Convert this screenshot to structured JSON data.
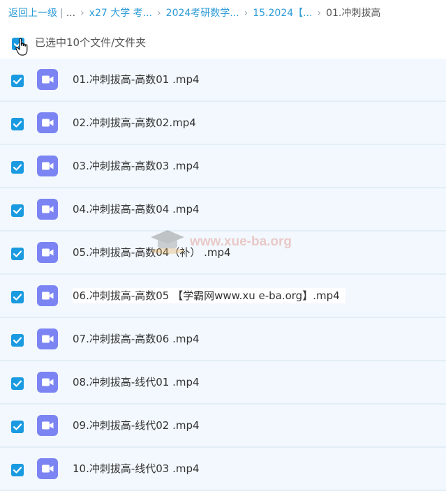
{
  "breadcrumb": {
    "back": "返回上一级",
    "ellipsis": "...",
    "crumb1": "x27 大学 考...",
    "crumb2": "2024考研数学...",
    "crumb3": "15.2024【...",
    "current": "01.冲刺拔高"
  },
  "selection": {
    "text": "已选中10个文件/文件夹",
    "all_checked": true
  },
  "files": [
    {
      "name": "01.冲刺拔高-高数01 .mp4",
      "checked": true
    },
    {
      "name": "02.冲刺拔高-高数02.mp4",
      "checked": true
    },
    {
      "name": "03.冲刺拔高-高数03 .mp4",
      "checked": true
    },
    {
      "name": "04.冲刺拔高-高数04 .mp4",
      "checked": true
    },
    {
      "name": "05.冲刺拔高-高数04（补） .mp4",
      "checked": true
    },
    {
      "name": "06.冲刺拔高-高数05 【学霸网www.xu e-ba.org】.mp4",
      "checked": true
    },
    {
      "name": "07.冲刺拔高-高数06 .mp4",
      "checked": true
    },
    {
      "name": "08.冲刺拔高-线代01 .mp4",
      "checked": true
    },
    {
      "name": "09.冲刺拔高-线代02 .mp4",
      "checked": true
    },
    {
      "name": "10.冲刺拔高-线代03 .mp4",
      "checked": true
    }
  ],
  "watermark": "www.xue-ba.org",
  "colors": {
    "accent": "#2c9bd8",
    "checkbox": "#1a9ae0",
    "video_icon": "#7b84f2",
    "row_bg": "#f2f8fd"
  }
}
